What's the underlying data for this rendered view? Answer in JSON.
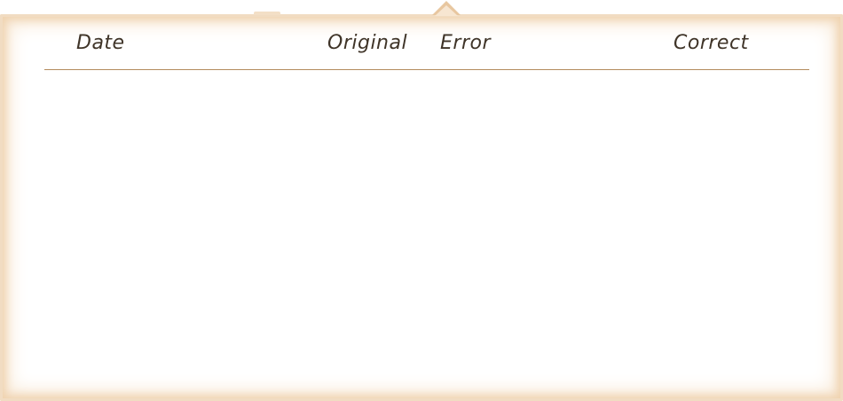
{
  "table": {
    "columns": {
      "date": "Date",
      "original": "Original",
      "error": "Error",
      "correct": "Correct"
    },
    "rows": []
  }
}
